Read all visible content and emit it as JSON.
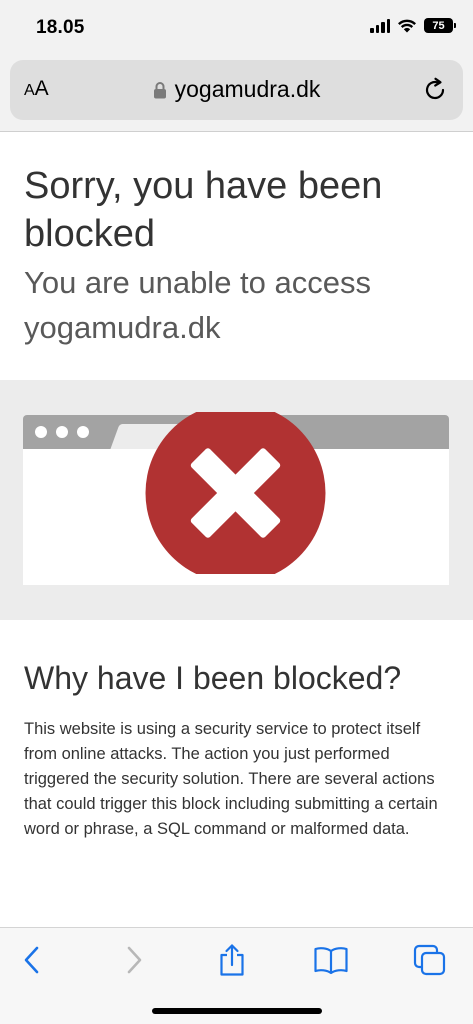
{
  "status_bar": {
    "time": "18.05",
    "battery": "75"
  },
  "address_bar": {
    "aa_small": "A",
    "aa_large": "A",
    "url": "yogamudra.dk",
    "secure_icon": "lock-icon",
    "reload_icon": "reload-icon"
  },
  "page": {
    "title": "Sorry, you have been blocked",
    "subtitle": "You are unable to access yogamudra.dk",
    "why_title": "Why have I been blocked?",
    "why_body": "This website is using a security service to protect itself from online attacks. The action you just performed triggered the security solution. There are several actions that could trigger this block including submitting a certain word or phrase, a SQL command or malformed data."
  },
  "toolbar": {
    "back_icon": "chevron-left-icon",
    "forward_icon": "chevron-right-icon",
    "share_icon": "share-icon",
    "bookmarks_icon": "book-icon",
    "tabs_icon": "tabs-icon"
  },
  "colors": {
    "accent": "#1a73e8",
    "block_red": "#b13232",
    "disabled": "#b8b8b8"
  }
}
